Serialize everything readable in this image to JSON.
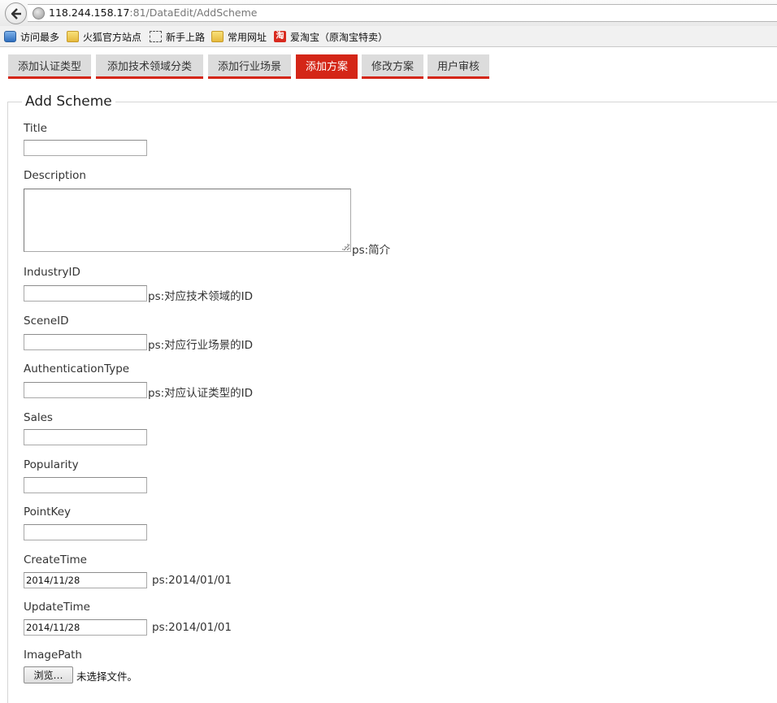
{
  "browser": {
    "url_host": "118.244.158.17",
    "url_path": ":81/DataEdit/AddScheme",
    "bookmarks": [
      {
        "label": "访问最多",
        "icon": "most-visited-icon"
      },
      {
        "label": "火狐官方站点",
        "icon": "folder-icon"
      },
      {
        "label": "新手上路",
        "icon": "dashed-page-icon"
      },
      {
        "label": "常用网址",
        "icon": "folder-icon"
      },
      {
        "label": "爱淘宝（原淘宝特卖）",
        "icon": "taobao-icon"
      }
    ],
    "taobao_glyph": "淘"
  },
  "tabs": [
    {
      "label": "添加认证类型",
      "active": false
    },
    {
      "label": "添加技术领域分类",
      "active": false
    },
    {
      "label": "添加行业场景",
      "active": false
    },
    {
      "label": "添加方案",
      "active": true
    },
    {
      "label": "修改方案",
      "active": false
    },
    {
      "label": "用户审核",
      "active": false
    }
  ],
  "form": {
    "legend": "Add Scheme",
    "title": {
      "label": "Title",
      "value": ""
    },
    "description": {
      "label": "Description",
      "value": "",
      "hint": "ps:简介"
    },
    "industry_id": {
      "label": "IndustryID",
      "value": "",
      "hint": "ps:对应技术领域的ID"
    },
    "scene_id": {
      "label": "SceneID",
      "value": "",
      "hint": "ps:对应行业场景的ID"
    },
    "authentication_type": {
      "label": "AuthenticationType",
      "value": "",
      "hint": "ps:对应认证类型的ID"
    },
    "sales": {
      "label": "Sales",
      "value": ""
    },
    "popularity": {
      "label": "Popularity",
      "value": ""
    },
    "point_key": {
      "label": "PointKey",
      "value": ""
    },
    "create_time": {
      "label": "CreateTime",
      "value": "2014/11/28",
      "hint": "ps:2014/01/01"
    },
    "update_time": {
      "label": "UpdateTime",
      "value": "2014/11/28",
      "hint": "ps:2014/01/01"
    },
    "image_path": {
      "label": "ImagePath",
      "browse_label": "浏览…",
      "status": "未选择文件。"
    }
  },
  "colors": {
    "accent": "#d42617",
    "tab_bg": "#dcdcdc"
  }
}
